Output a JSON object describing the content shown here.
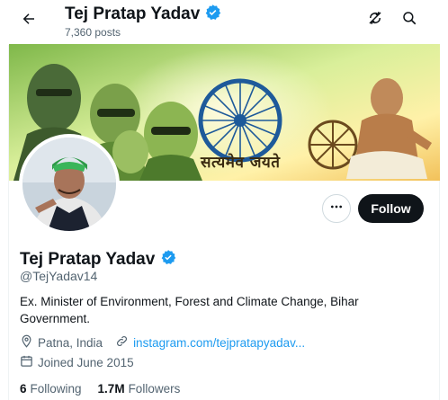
{
  "header": {
    "name": "Tej Pratap Yadav",
    "posts_count": "7,360 posts"
  },
  "banner": {
    "motto": "सत्यमेव जयते"
  },
  "actions": {
    "follow_label": "Follow"
  },
  "profile": {
    "name": "Tej Pratap Yadav",
    "handle": "@TejYadav14",
    "bio": "Ex. Minister of Environment, Forest and Climate Change, Bihar Government.",
    "location": "Patna, India",
    "website": "instagram.com/tejpratapyadav...",
    "joined": "Joined June 2015",
    "following_count": "6",
    "following_label": "Following",
    "followers_count": "1.7M",
    "followers_label": "Followers"
  },
  "colors": {
    "verified_blue": "#1d9bf0",
    "text_primary": "#0f1419",
    "text_secondary": "#536471",
    "follow_button_bg": "#0f1419"
  },
  "icons": {
    "back": "arrow-left-icon",
    "verified": "verified-badge-icon",
    "refresh": "refresh-icon",
    "search": "search-icon",
    "more": "more-dots-icon",
    "location": "location-pin-icon",
    "link": "link-icon",
    "calendar": "calendar-icon"
  }
}
